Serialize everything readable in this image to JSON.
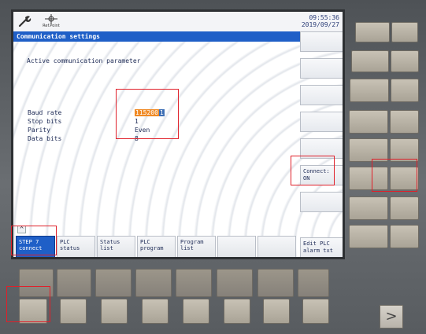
{
  "header": {
    "refpoint_label": "Ref.Point",
    "time": "09:55:36",
    "date": "2019/09/27"
  },
  "window": {
    "title": "Communication settings",
    "section_title": "Active communication parameter"
  },
  "params": [
    {
      "label": "Baud rate",
      "value_digits": "115200",
      "value_cursor": "1"
    },
    {
      "label": "Stop bits",
      "value": "1"
    },
    {
      "label": "Parity",
      "value": "Even"
    },
    {
      "label": "Data bits",
      "value": "8"
    }
  ],
  "vertical_softkeys": [
    {
      "label": ""
    },
    {
      "label": ""
    },
    {
      "label": ""
    },
    {
      "label": ""
    },
    {
      "label": ""
    },
    {
      "label_line1": "Connect:",
      "label_line2": "ON"
    },
    {
      "label": ""
    },
    {
      "label_line1": "Edit PLC",
      "label_line2": "alarm txt"
    }
  ],
  "horizontal_softkeys": [
    {
      "line1": "STEP 7",
      "line2": "connect"
    },
    {
      "line1": "PLC",
      "line2": "status"
    },
    {
      "line1": "Status",
      "line2": "list"
    },
    {
      "line1": "PLC",
      "line2": "program"
    },
    {
      "line1": "Program",
      "line2": "list"
    },
    {
      "line1": "",
      "line2": ""
    },
    {
      "line1": "",
      "line2": ""
    }
  ],
  "caret_symbol": "^",
  "arrow_symbol": ">",
  "colors": {
    "title_bar": "#1f5fc7",
    "baud_highlight": "#f08a25",
    "annotation": "#e0202a",
    "active_softkey": "#1f5fc7"
  }
}
